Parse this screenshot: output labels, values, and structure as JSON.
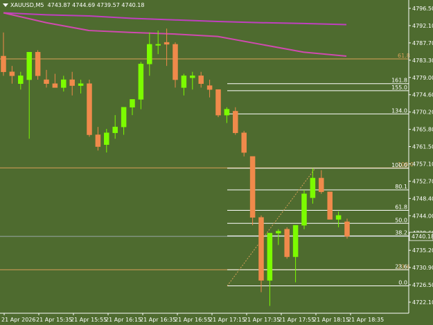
{
  "symbol_header": {
    "symbol": "XAUUSD,M5",
    "ohlc": "4743.87 4744.69 4739.57 4740.18"
  },
  "colors": {
    "background": "#4e6b2f",
    "bull": "#7cfc00",
    "bear": "#f08a4b",
    "text": "#ffffff",
    "ma_slow": "#c040c0",
    "ma_fast": "#d04ab0",
    "fib_line": "#ffffff",
    "fib_level_orange": "#d9a05a",
    "current_price_line": "#9aa7a7"
  },
  "price_axis": {
    "labels": [
      "4796.50",
      "4792.10",
      "4787.70",
      "4783.30",
      "4779.00",
      "4774.60",
      "4770.20",
      "4765.80",
      "4761.50",
      "4757.10",
      "4752.70",
      "4748.40",
      "4744.00",
      "4739.60",
      "4735.20",
      "4730.90",
      "4726.50",
      "4722.10"
    ],
    "current_price": "4740.18"
  },
  "time_axis": {
    "labels": [
      "21 Apr 2026",
      "21 Apr 15:35",
      "21 Apr 15:55",
      "21 Apr 16:15",
      "21 Apr 16:35",
      "21 Apr 16:55",
      "21 Apr 17:15",
      "21 Apr 17:35",
      "21 Apr 17:55",
      "21 Apr 18:15",
      "21 Apr 18:35"
    ]
  },
  "fib_levels": [
    {
      "label": "161.8",
      "price": 4779.0
    },
    {
      "label": "155.0",
      "price": 4777.2
    },
    {
      "label": "134.0",
      "price": 4771.3
    },
    {
      "label": "100.0",
      "price": 4757.5
    },
    {
      "label": "80.1",
      "price": 4752.0
    },
    {
      "label": "61.8",
      "price": 4746.8
    },
    {
      "label": "50.0",
      "price": 4743.5
    },
    {
      "label": "38.2",
      "price": 4740.3
    },
    {
      "label": "23.6",
      "price": 4731.7
    },
    {
      "label": "0.0",
      "price": 4727.6
    }
  ],
  "horizontal_levels": [
    {
      "label": "61.8",
      "price": 4785.3
    },
    {
      "label": "100.0",
      "price": 4757.6
    },
    {
      "label": "23.6",
      "price": 4731.7
    }
  ],
  "chart_data": {
    "type": "candlestick",
    "title": "XAUUSD,M5",
    "ylim": [
      4721.0,
      4798.5
    ],
    "candles": [
      {
        "o": 4786.0,
        "h": 4792.0,
        "l": 4781.0,
        "c": 4782.0
      },
      {
        "o": 4782.0,
        "h": 4783.5,
        "l": 4779.0,
        "c": 4781.0
      },
      {
        "o": 4779.0,
        "h": 4782.0,
        "l": 4777.5,
        "c": 4781.0
      },
      {
        "o": 4780.0,
        "h": 4787.0,
        "l": 4765.0,
        "c": 4787.0
      },
      {
        "o": 4787.0,
        "h": 4787.5,
        "l": 4780.0,
        "c": 4781.0
      },
      {
        "o": 4780.0,
        "h": 4782.5,
        "l": 4778.0,
        "c": 4779.0
      },
      {
        "o": 4779.0,
        "h": 4781.5,
        "l": 4778.0,
        "c": 4778.0
      },
      {
        "o": 4778.0,
        "h": 4781.0,
        "l": 4777.0,
        "c": 4780.0
      },
      {
        "o": 4780.0,
        "h": 4782.0,
        "l": 4776.0,
        "c": 4778.5
      },
      {
        "o": 4778.5,
        "h": 4780.0,
        "l": 4776.5,
        "c": 4779.0
      },
      {
        "o": 4779.0,
        "h": 4780.0,
        "l": 4765.5,
        "c": 4766.0
      },
      {
        "o": 4766.0,
        "h": 4768.0,
        "l": 4762.0,
        "c": 4763.0
      },
      {
        "o": 4763.5,
        "h": 4767.5,
        "l": 4761.5,
        "c": 4766.5
      },
      {
        "o": 4766.5,
        "h": 4771.0,
        "l": 4765.0,
        "c": 4768.0
      },
      {
        "o": 4768.0,
        "h": 4773.0,
        "l": 4766.0,
        "c": 4773.0
      },
      {
        "o": 4773.0,
        "h": 4775.0,
        "l": 4771.0,
        "c": 4775.0
      },
      {
        "o": 4775.0,
        "h": 4784.5,
        "l": 4772.5,
        "c": 4784.0
      },
      {
        "o": 4784.0,
        "h": 4792.0,
        "l": 4781.0,
        "c": 4789.0
      },
      {
        "o": 4789.0,
        "h": 4792.5,
        "l": 4786.5,
        "c": 4789.0
      },
      {
        "o": 4789.5,
        "h": 4793.0,
        "l": 4783.5,
        "c": 4789.0
      },
      {
        "o": 4789.0,
        "h": 4789.5,
        "l": 4778.0,
        "c": 4780.0
      },
      {
        "o": 4778.0,
        "h": 4781.5,
        "l": 4776.0,
        "c": 4781.0
      },
      {
        "o": 4780.5,
        "h": 4782.0,
        "l": 4777.5,
        "c": 4781.0
      },
      {
        "o": 4781.0,
        "h": 4782.0,
        "l": 4778.0,
        "c": 4779.0
      },
      {
        "o": 4778.5,
        "h": 4780.0,
        "l": 4775.5,
        "c": 4777.5
      },
      {
        "o": 4777.5,
        "h": 4777.5,
        "l": 4770.5,
        "c": 4771.0
      },
      {
        "o": 4771.0,
        "h": 4773.0,
        "l": 4769.0,
        "c": 4772.5
      },
      {
        "o": 4772.0,
        "h": 4773.0,
        "l": 4766.0,
        "c": 4766.5
      },
      {
        "o": 4766.5,
        "h": 4767.0,
        "l": 4760.5,
        "c": 4761.5
      },
      {
        "o": 4760.5,
        "h": 4760.5,
        "l": 4743.0,
        "c": 4745.0
      },
      {
        "o": 4745.0,
        "h": 4745.5,
        "l": 4726.0,
        "c": 4729.0
      },
      {
        "o": 4729.0,
        "h": 4741.0,
        "l": 4722.5,
        "c": 4741.0
      },
      {
        "o": 4741.0,
        "h": 4742.0,
        "l": 4738.0,
        "c": 4741.5
      },
      {
        "o": 4742.0,
        "h": 4742.5,
        "l": 4734.5,
        "c": 4735.0
      },
      {
        "o": 4735.0,
        "h": 4743.0,
        "l": 4728.5,
        "c": 4743.0
      },
      {
        "o": 4743.0,
        "h": 4752.0,
        "l": 4742.0,
        "c": 4751.0
      },
      {
        "o": 4750.0,
        "h": 4757.5,
        "l": 4748.5,
        "c": 4755.0
      },
      {
        "o": 4755.0,
        "h": 4757.0,
        "l": 4751.0,
        "c": 4751.5
      },
      {
        "o": 4751.5,
        "h": 4751.5,
        "l": 4744.5,
        "c": 4744.5
      },
      {
        "o": 4744.5,
        "h": 4746.5,
        "l": 4742.5,
        "c": 4745.5
      },
      {
        "o": 4743.9,
        "h": 4744.7,
        "l": 4739.6,
        "c": 4740.2
      }
    ],
    "ma_fast": [
      4797.0,
      4794.5,
      4792.5,
      4792.0,
      4791.6,
      4791.0,
      4789.0,
      4787.0,
      4786.0
    ],
    "ma_slow": [
      4797.0,
      4796.5,
      4796.2,
      4795.6,
      4795.2,
      4794.8,
      4794.5,
      4794.3,
      4794.0
    ]
  }
}
